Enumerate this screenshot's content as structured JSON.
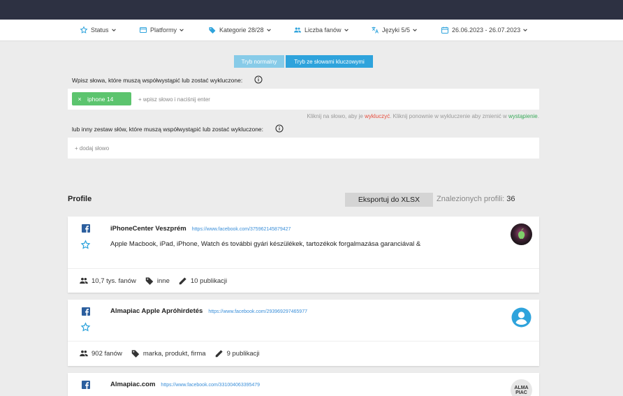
{
  "filters": [
    {
      "label": "Status",
      "icon": "star-outline-icon"
    },
    {
      "label": "Platformy",
      "icon": "window-icon"
    },
    {
      "label": "Kategorie 28/28",
      "icon": "tag-icon"
    },
    {
      "label": "Liczba fanów",
      "icon": "people-icon"
    },
    {
      "label": "Języki 5/5",
      "icon": "translate-icon"
    },
    {
      "label": "26.06.2023 - 26.07.2023",
      "icon": "calendar-icon"
    }
  ],
  "modes": {
    "normal": "Tryb normalny",
    "keywords": "Tryb ze słowami kluczowymi"
  },
  "keywords": {
    "label1": "Wpisz słowa, które muszą współwystąpić lub zostać wykluczone:",
    "chip": "iphone 14",
    "chip_remove": "×",
    "input_placeholder": "+ wpisz słowo i naciśnij enter",
    "hint_a": "Kliknij na słowo, aby je ",
    "hint_exclude": "wykluczyć",
    "hint_b": ". Kliknij ponownie w wykluczenie aby zmienić w ",
    "hint_cooccur": "wystąpienie",
    "hint_c": ".",
    "label2": "lub inny zestaw słów, które muszą współwystąpić lub zostać wykluczone:",
    "add_word": "+ dodaj słowo"
  },
  "profiles_section": {
    "title": "Profile",
    "export_label": "Eksportuj do XLSX",
    "found_label": "Znalezionych profili: ",
    "found_count": "36"
  },
  "profiles": [
    {
      "name": "iPhoneCenter Veszprém",
      "url": "https://www.facebook.com/375962145879427",
      "description": "Apple Macbook, iPad, iPhone, Watch és további gyári készülékek, tartozékok forgalmazása garanciával &",
      "fans": "10,7 tys. fanów",
      "category": "inne",
      "posts": "10 publikacji"
    },
    {
      "name": "Almapiac Apple Apróhirdetés",
      "url": "https://www.facebook.com/293969297465977",
      "description": "",
      "fans": "902 fanów",
      "category": "marka, produkt, firma",
      "posts": "9 publikacji"
    },
    {
      "name": "Almapiac.com",
      "url": "https://www.facebook.com/331004063395479",
      "description": "",
      "avatar_text": "ALMA PIAC"
    }
  ],
  "colors": {
    "topbar": "#2d3142",
    "mode_normal": "#87cbe8",
    "mode_active": "#2ea3dc",
    "chip": "#5cc46e",
    "link": "#3b8fd9",
    "exclude": "#e74c3c",
    "cooccur": "#3aaa5a"
  }
}
